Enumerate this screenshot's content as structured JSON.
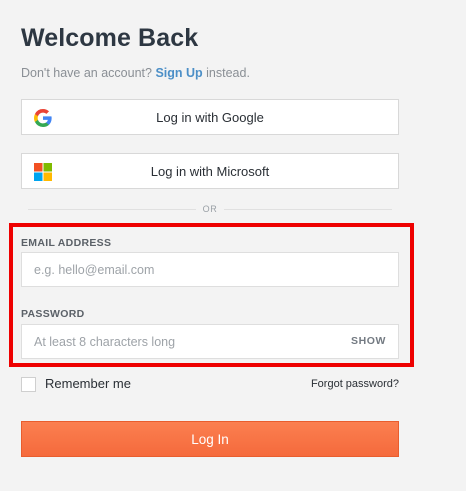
{
  "header": {
    "title": "Welcome Back",
    "subtitle_prefix": "Don't have an account?",
    "signup_link": "Sign Up",
    "subtitle_suffix": "instead."
  },
  "social": {
    "google_label": "Log in with Google",
    "microsoft_label": "Log in with Microsoft",
    "divider_text": "OR"
  },
  "form": {
    "email_label": "EMAIL ADDRESS",
    "email_placeholder": "e.g. hello@email.com",
    "email_value": "",
    "password_label": "PASSWORD",
    "password_placeholder": "At least 8 characters long",
    "password_value": "",
    "show_toggle": "SHOW",
    "remember_label": "Remember me",
    "remember_checked": false,
    "forgot_link": "Forgot password?",
    "submit_label": "Log In"
  },
  "colors": {
    "background": "#f3f3f3",
    "accent_link": "#4c8fc7",
    "primary_button": "#f7703f",
    "highlight_outline": "#ee0000"
  },
  "icons": {
    "google": "google-logo-icon",
    "microsoft": "microsoft-logo-icon"
  }
}
